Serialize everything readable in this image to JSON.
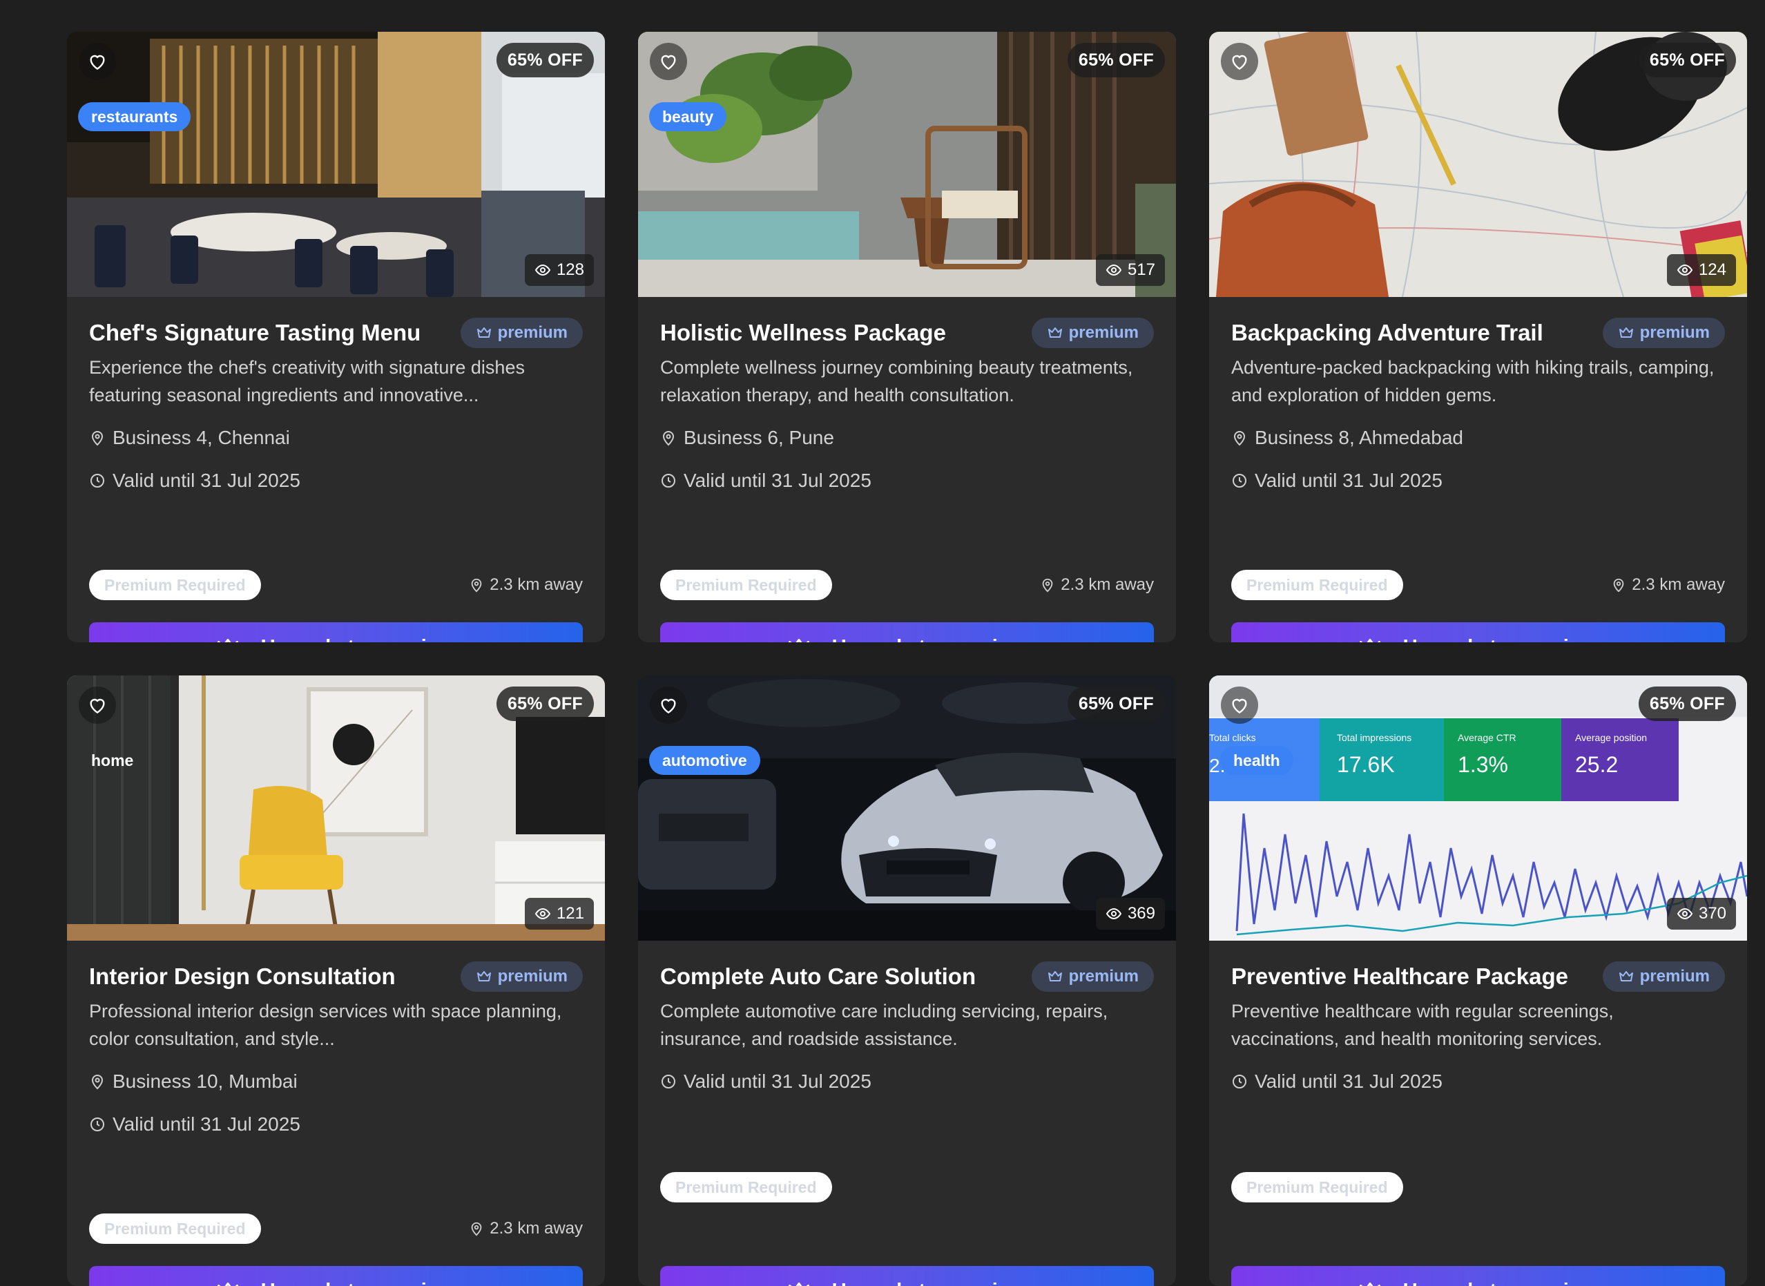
{
  "cards": [
    {
      "discount": "65% OFF",
      "category": "restaurants",
      "category_style": "pill",
      "views": "128",
      "title": "Chef's Signature Tasting Menu",
      "badge": "premium",
      "description": "Experience the chef's creativity with signature dishes featuring seasonal ingredients and innovative...",
      "location": "Business 4, Chennai",
      "valid": "Valid until 31 Jul 2025",
      "requirement": "Premium Required",
      "distance": "2.3 km away",
      "cta": "Upgrade to premium",
      "image_theme": "restaurant"
    },
    {
      "discount": "65% OFF",
      "category": "beauty",
      "category_style": "pill",
      "views": "517",
      "title": "Holistic Wellness Package",
      "badge": "premium",
      "description": "Complete wellness journey combining beauty treatments, relaxation therapy, and health consultation.",
      "location": "Business 6, Pune",
      "valid": "Valid until 31 Jul 2025",
      "requirement": "Premium Required",
      "distance": "2.3 km away",
      "cta": "Upgrade to premium",
      "image_theme": "spa"
    },
    {
      "discount": "65% OFF",
      "category": "",
      "category_style": "none",
      "views": "124",
      "title": "Backpacking Adventure Trail",
      "badge": "premium",
      "description": "Adventure-packed backpacking with hiking trails, camping, and exploration of hidden gems.",
      "location": "Business 8, Ahmedabad",
      "valid": "Valid until 31 Jul 2025",
      "requirement": "Premium Required",
      "distance": "2.3 km away",
      "cta": "Upgrade to premium",
      "image_theme": "travel"
    },
    {
      "discount": "65% OFF",
      "category": "home",
      "category_style": "plain",
      "views": "121",
      "title": "Interior Design Consultation",
      "badge": "premium",
      "description": "Professional interior design services with space planning, color consultation, and style...",
      "location": "Business 10, Mumbai",
      "valid": "Valid until 31 Jul 2025",
      "requirement": "Premium Required",
      "distance": "2.3 km away",
      "cta": "Upgrade to premium",
      "image_theme": "interior"
    },
    {
      "discount": "65% OFF",
      "category": "automotive",
      "category_style": "pill",
      "views": "369",
      "title": "Complete Auto Care Solution",
      "badge": "premium",
      "description": "Complete automotive care including servicing, repairs, insurance, and roadside assistance.",
      "location": "",
      "valid": "Valid until 31 Jul 2025",
      "requirement": "Premium Required",
      "distance": "",
      "cta": "Upgrade to premium",
      "image_theme": "car"
    },
    {
      "discount": "65% OFF",
      "category": "health",
      "category_style": "pill",
      "views": "370",
      "title": "Preventive Healthcare Package",
      "badge": "premium",
      "description": "Preventive healthcare with regular screenings, vaccinations, and health monitoring services.",
      "location": "",
      "valid": "Valid until 31 Jul 2025",
      "requirement": "Premium Required",
      "distance": "",
      "cta": "Upgrade to premium",
      "image_theme": "analytics",
      "image_text": {
        "clicks_label": "Total clicks",
        "clicks_value": "2.",
        "impressions_label": "Total impressions",
        "impressions_value": "17.6K",
        "ctr_label": "Average CTR",
        "ctr_value": "1.3%",
        "position_label": "Average position",
        "position_value": "25.2"
      }
    }
  ],
  "colors": {
    "page_bg": "#1f1f1f",
    "card_bg": "#2b2b2b",
    "category_pill": "#3b82f6",
    "premium_badge_bg": "#3a4152",
    "premium_badge_text": "#9ab8f5",
    "cta_gradient_start": "#7c3aed",
    "cta_gradient_end": "#2563eb"
  },
  "icons": {
    "favorite": "heart-outline-icon",
    "views": "eye-icon",
    "badge": "crown-icon",
    "location": "map-pin-icon",
    "validity": "clock-icon",
    "cta": "crown-icon"
  }
}
